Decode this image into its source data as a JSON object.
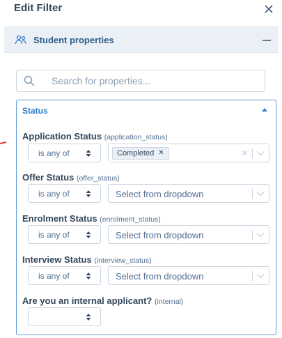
{
  "header": {
    "title": "Edit Filter",
    "close_icon": "close-icon"
  },
  "section": {
    "title": "Student properties",
    "icon": "people-icon",
    "collapse_icon": "minus-icon"
  },
  "search": {
    "placeholder": "Search for properties...",
    "value": ""
  },
  "panel": {
    "title": "Status",
    "fields": [
      {
        "label": "Application Status",
        "internal": "(application_status)",
        "operator": "is any of",
        "tag": "Completed",
        "placeholder": ""
      },
      {
        "label": "Offer Status",
        "internal": "(offer_status)",
        "operator": "is any of",
        "placeholder": "Select from dropdown"
      },
      {
        "label": "Enrolment Status",
        "internal": "(enrolment_status)",
        "operator": "is any of",
        "placeholder": "Select from dropdown"
      },
      {
        "label": "Interview Status",
        "internal": "(interview_status)",
        "operator": "is any of",
        "placeholder": "Select from dropdown"
      },
      {
        "label": "Are you an internal applicant?",
        "internal": "(internal)",
        "operator": ""
      }
    ]
  },
  "colors": {
    "accent": "#2d7bc9",
    "section_bg": "#eaf0f6",
    "arrow": "#e0392b"
  }
}
